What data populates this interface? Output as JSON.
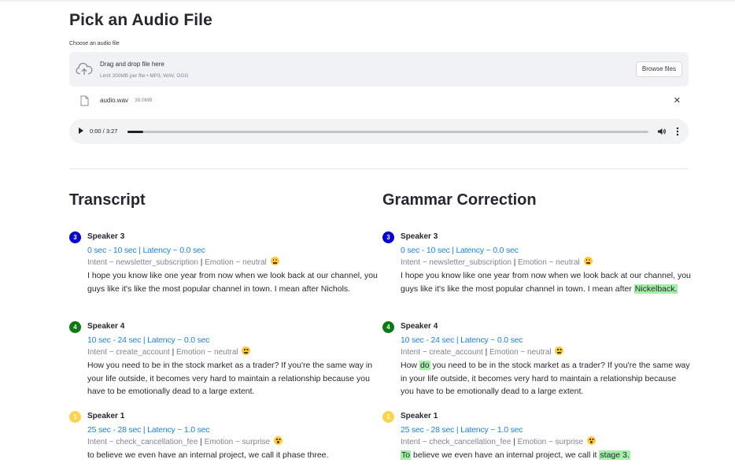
{
  "header": {
    "title": "Pick an Audio File"
  },
  "uploader": {
    "label": "Choose an audio file",
    "drop_title": "Drag and drop file here",
    "drop_limit": "Limit 200MB per file • MP3, WAV, OGG",
    "browse_label": "Browse files",
    "file_name": "audio.wav",
    "file_size": "38.0MB"
  },
  "player": {
    "time": "0:00 / 3:27",
    "progress": 0.03
  },
  "transcript": {
    "title": "Transcript",
    "entries": [
      {
        "badge": "3",
        "speaker": "Speaker 3",
        "timing": "0 sec - 10 sec | Latency ~ 0.0 sec",
        "intent": "Intent ~ newsletter_subscription",
        "emotion": "Emotion ~ neutral",
        "text": "I hope you know like one year from now when we look back at our channel, you guys like it's like the most popular channel in town. I mean after Nichols."
      },
      {
        "badge": "4",
        "speaker": "Speaker 4",
        "timing": "10 sec - 24 sec | Latency ~ 0.0 sec",
        "intent": "Intent ~ create_account",
        "emotion": "Emotion ~ neutral",
        "text": "How you need to be in the stock market as a trader? If you're the same way in your life outside, it becomes very hard to maintain a relationship because you have to be emotionally dead to a large extent."
      },
      {
        "badge": "1",
        "speaker": "Speaker 1",
        "timing": "25 sec - 28 sec | Latency ~ 1.0 sec",
        "intent": "Intent ~ check_cancellation_fee",
        "emotion": "Emotion ~ surprise",
        "text": "to believe we even have an internal project, we call it phase three."
      }
    ]
  },
  "grammar": {
    "title": "Grammar Correction",
    "entries": [
      {
        "badge": "3",
        "speaker": "Speaker 3",
        "timing": "0 sec - 10 sec | Latency ~ 0.0 sec",
        "intent": "Intent ~ newsletter_subscription",
        "emotion": "Emotion ~ neutral",
        "text_a": "I hope you know like one year from now when we look back at our channel, you guys like it's like the most popular channel in town. I mean after ",
        "hl_a": "Nickelback."
      },
      {
        "badge": "4",
        "speaker": "Speaker 4",
        "timing": "10 sec - 24 sec | Latency ~ 0.0 sec",
        "intent": "Intent ~ create_account",
        "emotion": "Emotion ~ neutral",
        "text_a": "How ",
        "hl_a": "do",
        "text_b": " you need to be in the stock market as a trader? If you're the same way in your life outside, it becomes very hard to maintain a relationship because you have to be emotionally dead to a large extent."
      },
      {
        "badge": "1",
        "speaker": "Speaker 1",
        "timing": "25 sec - 28 sec | Latency ~ 1.0 sec",
        "intent": "Intent ~ check_cancellation_fee",
        "emotion": "Emotion ~ surprise",
        "hl_a": "To",
        "text_b": " believe we even have an internal project, we call it ",
        "hl_b": "stage 3."
      }
    ]
  },
  "colors": {
    "speaker_3": "#0000d6",
    "speaker_4": "#0b7a12",
    "speaker_1": "#ffd24d",
    "timing": "#1c83e1",
    "highlight": "#a4f0a8"
  }
}
